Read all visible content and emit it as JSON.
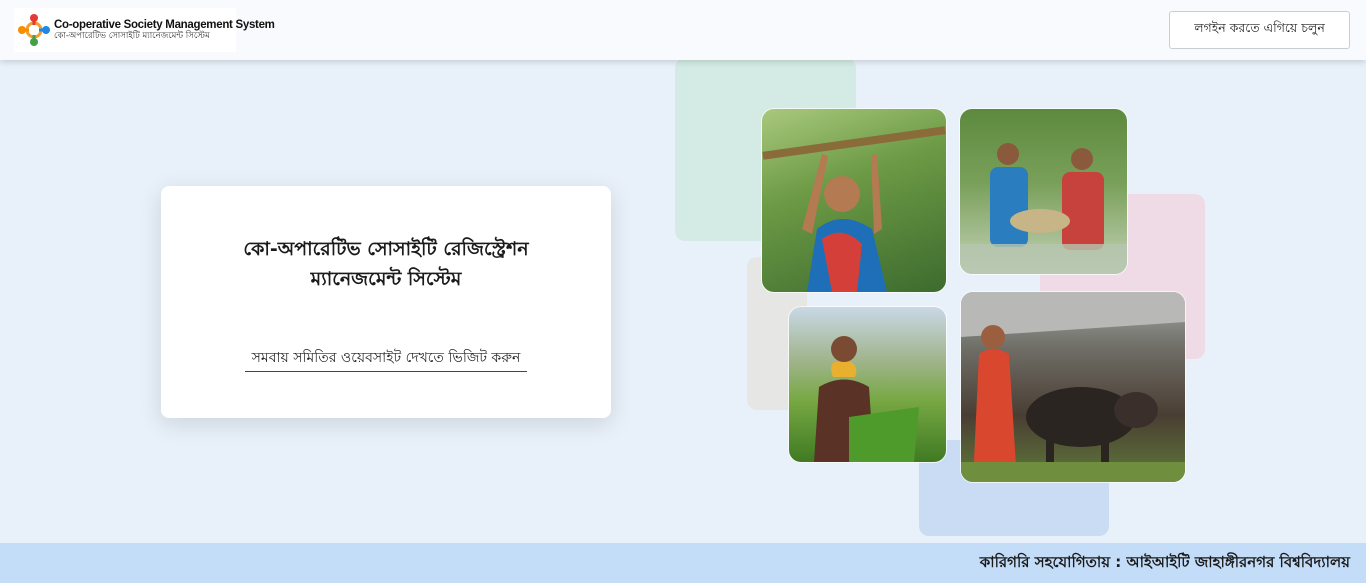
{
  "header": {
    "logo_title": "Co-operative Society Management System",
    "logo_subtitle": "কো-অপারেটিভ সোসাইটি ম্যানেজমেন্ট সিস্টেম",
    "login_label": "লগইন করতে এগিয়ে চলুন"
  },
  "hero": {
    "title_line1": "কো-অপারেটিভ সোসাইটি রেজিস্ট্রেশন",
    "title_line2": "ম্যানেজমেন্ট সিস্টেম",
    "visit_link": "সমবায় সমিতির ওয়েবসাইট দেখতে ভিজিট করুন"
  },
  "footer": {
    "credit": "কারিগরি সহযোগিতায় : আইআইটি জাহাঙ্গীরনগর বিশ্ববিদ্যালয়"
  },
  "colors": {
    "page_bg": "#e8f0fa",
    "footer_bg": "#c3dcf8",
    "card_bg": "#ffffff"
  }
}
